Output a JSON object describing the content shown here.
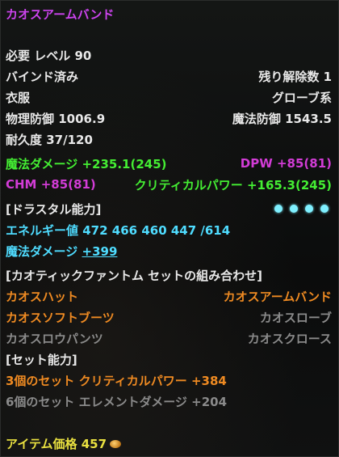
{
  "item": {
    "name": "カオスアームバンド",
    "required_level_label": "必要 レベル",
    "required_level": "90",
    "bind_status": "バインド済み",
    "unbind_label": "残り解除数",
    "unbind_count": "1",
    "category": "衣服",
    "subcategory": "グローブ系",
    "phys_def_label": "物理防御",
    "phys_def": "1006.9",
    "magic_def_label": "魔法防御",
    "magic_def": "1543.5",
    "durability_label": "耐久度",
    "durability": "37/120"
  },
  "stats": {
    "magic_damage": "魔法ダメージ +235.1(245)",
    "dpw": "DPW +85(81)",
    "chm": "CHM +85(81)",
    "critical_power": "クリティカルパワー +165.3(245)"
  },
  "drastal": {
    "header": "[ドラスタル能力]",
    "slots_filled": 4,
    "energy_label": "エネルギー値",
    "energy_values": "472 466 460 447 /614",
    "bonus_label": "魔法ダメージ",
    "bonus_value": "+399"
  },
  "set": {
    "header": "[カオティックファントム セットの組み合わせ]",
    "pieces": [
      {
        "name": "カオスハット",
        "owned": true
      },
      {
        "name": "カオスアームバンド",
        "owned": true
      },
      {
        "name": "カオスソフトブーツ",
        "owned": true
      },
      {
        "name": "カオスローブ",
        "owned": false
      },
      {
        "name": "カオスロウパンツ",
        "owned": false
      },
      {
        "name": "カオスクロース",
        "owned": false
      }
    ],
    "ability_header": "[セット能力]",
    "bonuses": [
      {
        "text": "3個のセット クリティカルパワー +384",
        "active": true
      },
      {
        "text": "6個のセット エレメントダメージ +204",
        "active": false
      }
    ]
  },
  "price": {
    "label": "アイテム価格",
    "value": "457"
  },
  "colors": {
    "title": "#cc44ee",
    "stat_green": "#44ee33",
    "stat_magenta": "#d23cd6",
    "cyan": "#4fdcff",
    "set_active": "#ee8a22",
    "set_inactive": "#8a8a8a",
    "price": "#e9e040"
  }
}
